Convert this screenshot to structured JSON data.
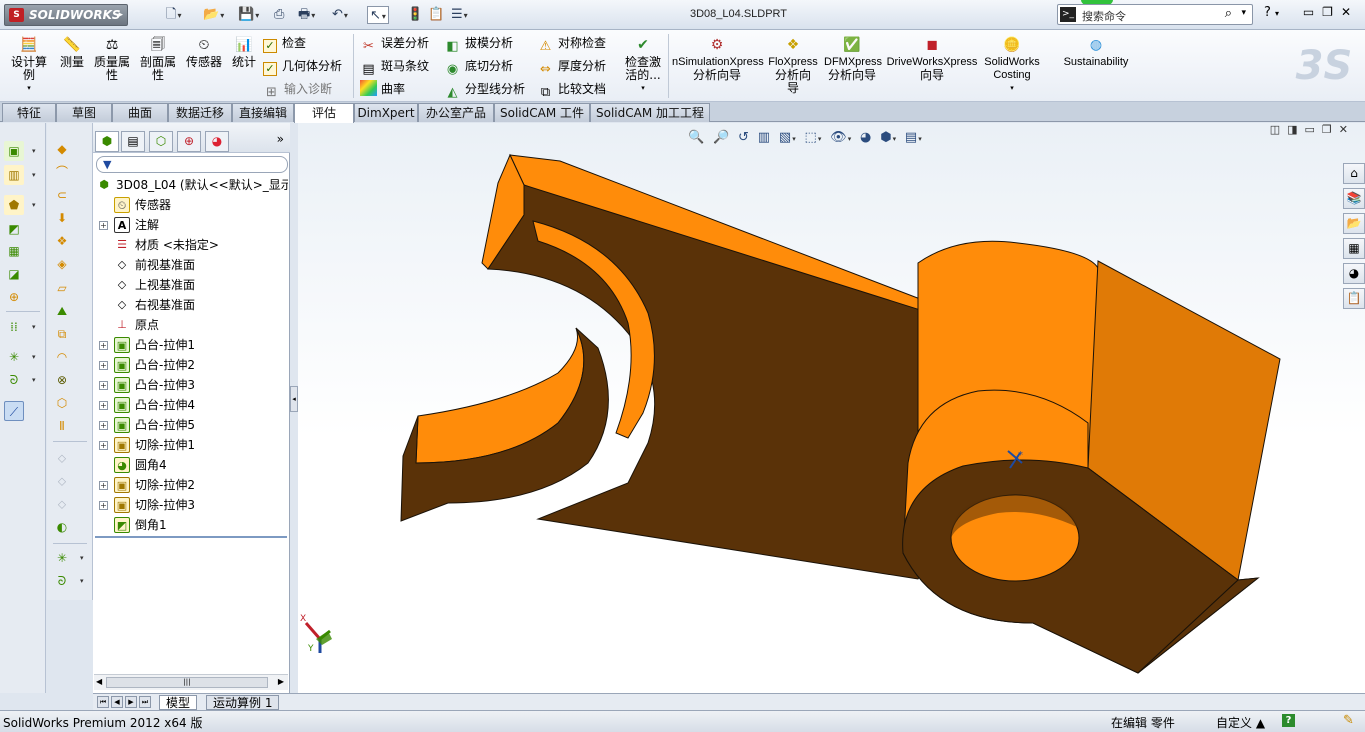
{
  "titlebar": {
    "app_name": "SOLIDWORKS",
    "document_title": "3D08_L04.SLDPRT",
    "search_placeholder": "搜索命令",
    "help_label": "?"
  },
  "commands": {
    "design_study": "设计算例",
    "measure": "测量",
    "mass_properties": "质量属性",
    "section_properties": "剖面属性",
    "sensor": "传感器",
    "statistics": "统计",
    "check": "检查",
    "geometry_analysis": "几何体分析",
    "import_diagnostics": "输入诊断",
    "deviation_analysis": "误差分析",
    "zebra_stripes": "斑马条纹",
    "curvature": "曲率",
    "draft_analysis": "拔模分析",
    "undercut_analysis": "底切分析",
    "parting_line_analysis": "分型线分析",
    "symmetry_check": "对称检查",
    "thickness_analysis": "厚度分析",
    "compare_documents": "比较文档",
    "check_active": "检查激活的...",
    "simulationxpress_line1": "nSimulationXpress",
    "simulationxpress_line2": "分析向导",
    "floxpress_line1": "FloXpress",
    "floxpress_line2": "分析向",
    "floxpress_line3": "导",
    "dfmxpress_line1": "DFMXpress",
    "dfmxpress_line2": "分析向导",
    "driveworks_line1": "DriveWorksXpress",
    "driveworks_line2": "向导",
    "costing_line1": "SolidWorks",
    "costing_line2": "Costing",
    "sustainability": "Sustainability"
  },
  "tabs": [
    {
      "label": "特征"
    },
    {
      "label": "草图"
    },
    {
      "label": "曲面"
    },
    {
      "label": "数据迁移"
    },
    {
      "label": "直接编辑"
    },
    {
      "label": "评估"
    },
    {
      "label": "DimXpert"
    },
    {
      "label": "办公室产品"
    },
    {
      "label": "SolidCAM 工件"
    },
    {
      "label": "SolidCAM 加工工程"
    }
  ],
  "feature_tree": {
    "root": "3D08_L04  (默认<<默认>_显示",
    "items": [
      {
        "label": "传感器"
      },
      {
        "label": "注解"
      },
      {
        "label": "材质 <未指定>"
      },
      {
        "label": "前视基准面"
      },
      {
        "label": "上视基准面"
      },
      {
        "label": "右视基准面"
      },
      {
        "label": "原点"
      },
      {
        "label": "凸台-拉伸1"
      },
      {
        "label": "凸台-拉伸2"
      },
      {
        "label": "凸台-拉伸3"
      },
      {
        "label": "凸台-拉伸4"
      },
      {
        "label": "凸台-拉伸5"
      },
      {
        "label": "切除-拉伸1"
      },
      {
        "label": "圆角4"
      },
      {
        "label": "切除-拉伸2"
      },
      {
        "label": "切除-拉伸3"
      },
      {
        "label": "倒角1"
      }
    ]
  },
  "bottom_tabs": {
    "model": "模型",
    "motion_study": "运动算例 1"
  },
  "status": {
    "product": "SolidWorks Premium 2012 x64 版",
    "editing": "在编辑 零件",
    "custom": "自定义 ▲",
    "help_icon": "?"
  },
  "triad": {
    "x": "X",
    "y": "Y"
  },
  "colors": {
    "model_light": "#ff8c0a",
    "model_mid": "#e07a06",
    "model_dark": "#5a3208",
    "accent_active_tab": "#ffffff"
  }
}
